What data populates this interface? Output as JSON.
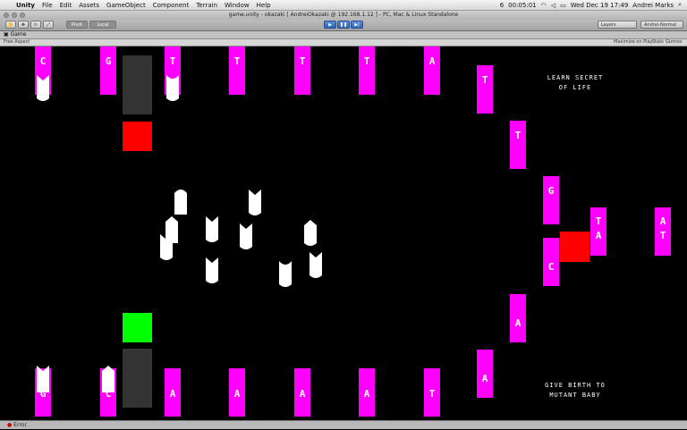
{
  "menubar": {
    "items": [
      "Unity",
      "File",
      "Edit",
      "Assets",
      "GameObject",
      "Component",
      "Terrain",
      "Window",
      "Help"
    ],
    "right_text": "6",
    "clock": "00:05:01",
    "date_time": "Wed Dec 19  17:49",
    "user": "Andrei Marks"
  },
  "window": {
    "title": "game.unity - okazaki [ AndreiOkazaki @ 192.168.1.12 ] - PC, Mac & Linux Standalone"
  },
  "toolbar": {
    "pivot_label": "Pivot",
    "local_label": "Local",
    "layers_label": "Layers",
    "layout_label": "Andrei-Normal"
  },
  "game_tab": {
    "label": "Game",
    "aspect_label": "Free Aspect",
    "maximize_label": "Maximize on Play",
    "stats_label": "Stats",
    "gizmos_label": "Gizmos"
  },
  "tiles_top": [
    "C",
    "G",
    "T",
    "T",
    "T",
    "T",
    "A"
  ],
  "tiles_bottom": [
    "G",
    "C",
    "A",
    "A",
    "A",
    "A",
    "T"
  ],
  "tiles_right": [
    "T",
    "T",
    "G",
    "C",
    "A",
    "A",
    "T",
    "A",
    "A",
    "T"
  ],
  "messages": {
    "top": [
      "LEARN SECRET",
      "OF LIFE"
    ],
    "bottom": [
      "GIVE BIRTH TO",
      "MUTANT BABY"
    ]
  },
  "status": {
    "text": "Error."
  },
  "colors": {
    "tile": "#ff00ff",
    "red_block": "#ff0000",
    "green_block": "#00ff00",
    "grey_block": "#333333"
  }
}
